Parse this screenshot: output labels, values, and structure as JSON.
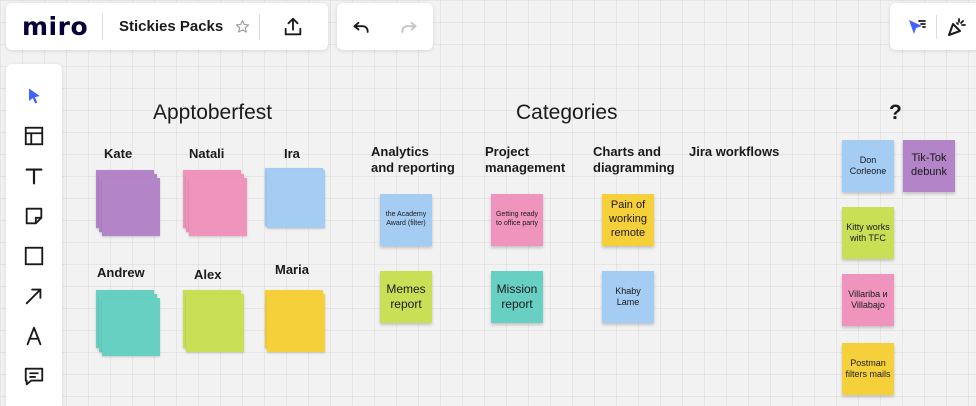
{
  "app": {
    "logo": "miro",
    "board_title": "Stickies Packs"
  },
  "icons": {
    "star": "star-icon",
    "export": "upload-icon",
    "undo": "undo-icon",
    "redo": "redo-icon",
    "select": "cursor-icon",
    "templates": "templates-icon",
    "text": "text-icon",
    "sticky": "sticky-note-icon",
    "shape": "rectangle-icon",
    "connector": "arrow-icon",
    "pen": "pen-icon",
    "comment": "comment-icon",
    "reactions": "reactions-icon",
    "celebrate": "party-popper-icon"
  },
  "colors": {
    "purple": "#b384c7",
    "pink": "#ef94bd",
    "blue": "#a5ccf3",
    "teal": "#68cfc3",
    "lime": "#c9df56",
    "yellow": "#f6d03b",
    "accent": "#4262ff"
  },
  "board": {
    "headings": {
      "apptoberfest": "Apptoberfest",
      "categories": "Categories",
      "unknown": "?"
    },
    "people": [
      {
        "name": "Kate"
      },
      {
        "name": "Natali"
      },
      {
        "name": "Ira"
      },
      {
        "name": "Andrew"
      },
      {
        "name": "Alex"
      },
      {
        "name": "Maria"
      }
    ],
    "categories": [
      {
        "label": "Analytics\nand reporting"
      },
      {
        "label": "Project\nmanagement"
      },
      {
        "label": "Charts and\ndiagramming"
      },
      {
        "label": "Jira workflows"
      }
    ],
    "notes": {
      "academy": "the Academy Award (filter)",
      "party": "Getting ready to office party",
      "pain": "Pain of working remote",
      "memes": "Memes report",
      "mission": "Mission report",
      "khaby": "Khaby Lame"
    },
    "unsorted": {
      "don": "Don Corleone",
      "tiktok": "Tik-Tok debunk",
      "kitty": "Kitty works with TFC",
      "villariba": "Villariba и Villabajo",
      "postman": "Postman filters mails"
    }
  }
}
